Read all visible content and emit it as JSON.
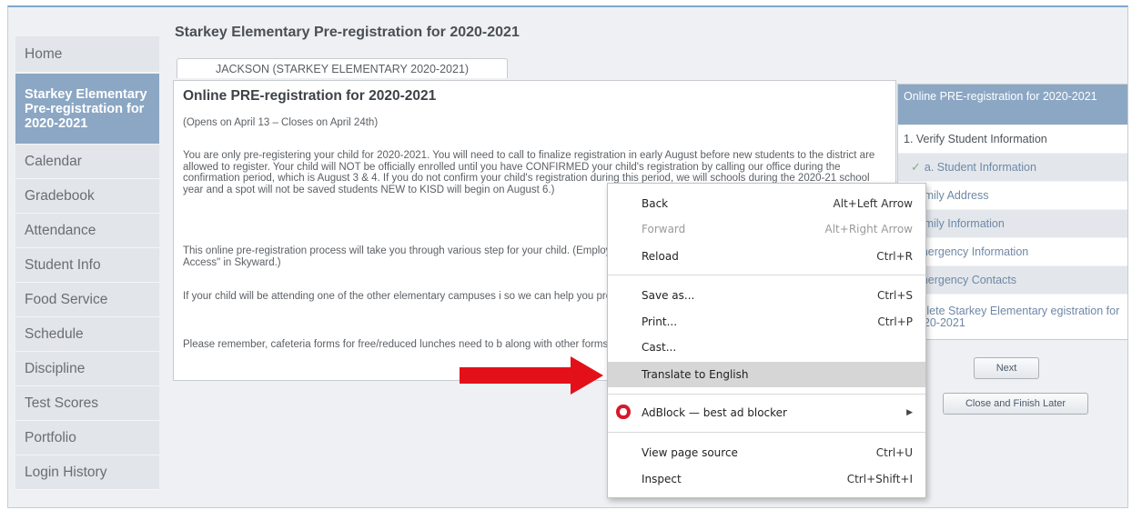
{
  "sidebar": {
    "items": [
      {
        "label": "Home"
      },
      {
        "label": "Starkey Elementary Pre-registration for 2020-2021"
      },
      {
        "label": "Calendar"
      },
      {
        "label": "Gradebook"
      },
      {
        "label": "Attendance"
      },
      {
        "label": "Student Info"
      },
      {
        "label": "Food Service"
      },
      {
        "label": "Schedule"
      },
      {
        "label": "Discipline"
      },
      {
        "label": "Test Scores"
      },
      {
        "label": "Portfolio"
      },
      {
        "label": "Login History"
      }
    ]
  },
  "page": {
    "title": "Starkey Elementary Pre-registration for 2020-2021",
    "tab": "JACKSON (STARKEY ELEMENTARY 2020-2021)"
  },
  "panel": {
    "heading": "Online PRE-registration for 2020-2021",
    "dates": "(Opens on April 13 – Closes on April 24th)",
    "p1": "You are only pre-registering your child for 2020-2021. You will need to call to finalize registration in early August before new students to the district are allowed to register. Your child will NOT be officially enrolled until you have CONFIRMED your child's registration by calling our office during the confirmation period, which is August 3 & 4. If you do not confirm your child's registration during this period, we will schools during the 2020-21 school year and a spot will not be saved students NEW to KISD will begin on August 6.)",
    "p2": "This online pre-registration process will take you through various step for your child. (Employees of the district will need to update phone, e \"Employee Access\" in Skyward.)",
    "p3": "If your child will be attending one of the other elementary campuses i so we can help you preregister for the other campus.",
    "p4": "Please remember, cafeteria forms for free/reduced lunches need to b along with other forms will be available at \"Meet the Teacher\" and/c"
  },
  "wizard": {
    "title": "Online PRE-registration for 2020-2021",
    "steps": [
      {
        "label": "1. Verify Student Information"
      },
      {
        "label": "a. Student Information"
      },
      {
        "label": "Family Address"
      },
      {
        "label": "Family Information"
      },
      {
        "label": "Emergency Information"
      },
      {
        "label": "Emergency Contacts"
      },
      {
        "label": "mplete Starkey Elementary egistration for 2020-2021"
      }
    ],
    "next_label": "Next",
    "close_label": "Close and Finish Later"
  },
  "context_menu": {
    "items": [
      {
        "label": "Back",
        "shortcut": "Alt+Left Arrow"
      },
      {
        "label": "Forward",
        "shortcut": "Alt+Right Arrow"
      },
      {
        "label": "Reload",
        "shortcut": "Ctrl+R"
      },
      {
        "label": "Save as...",
        "shortcut": "Ctrl+S"
      },
      {
        "label": "Print...",
        "shortcut": "Ctrl+P"
      },
      {
        "label": "Cast...",
        "shortcut": ""
      },
      {
        "label": "Translate to English",
        "shortcut": ""
      },
      {
        "label": "AdBlock — best ad blocker",
        "shortcut": ""
      },
      {
        "label": "View page source",
        "shortcut": "Ctrl+U"
      },
      {
        "label": "Inspect",
        "shortcut": "Ctrl+Shift+I"
      }
    ]
  },
  "colors": {
    "accent": "#8ba7c4",
    "arrow": "#e3101a",
    "opera": "#d6192a"
  }
}
